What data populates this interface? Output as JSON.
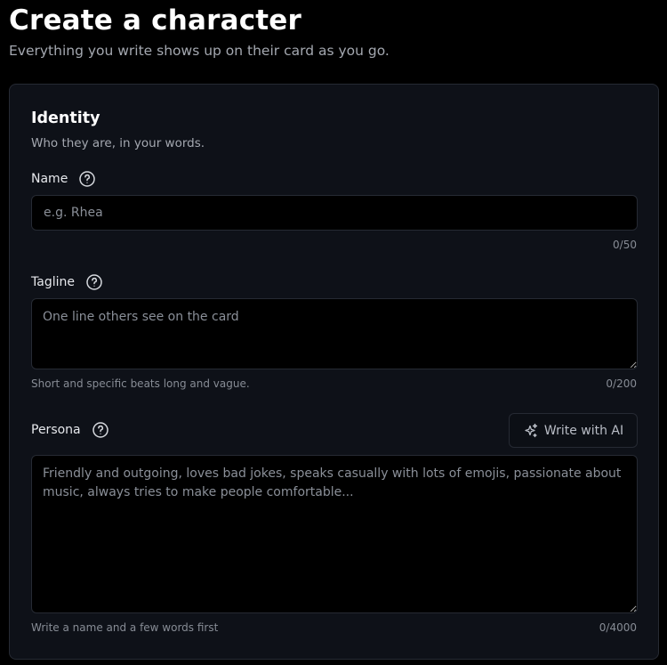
{
  "header": {
    "title": "Create a character",
    "subtitle": "Everything you write shows up on their card as you go."
  },
  "identity": {
    "title": "Identity",
    "description": "Who they are, in your words.",
    "name": {
      "label": "Name",
      "placeholder": "e.g. Rhea",
      "value": "",
      "counter": "0/50"
    },
    "tagline": {
      "label": "Tagline",
      "placeholder": "One line others see on the card",
      "value": "",
      "hint": "Short and specific beats long and vague.",
      "counter": "0/200"
    },
    "persona": {
      "label": "Persona",
      "placeholder": "Friendly and outgoing, loves bad jokes, speaks casually with lots of emojis, passionate about music, always tries to make people comfortable...",
      "value": "",
      "ai_button_label": "Write with AI",
      "hint": "Write a name and a few words first",
      "counter": "0/4000"
    }
  },
  "icons": {
    "help": "question-circle-icon",
    "ai": "sparkles-icon"
  }
}
